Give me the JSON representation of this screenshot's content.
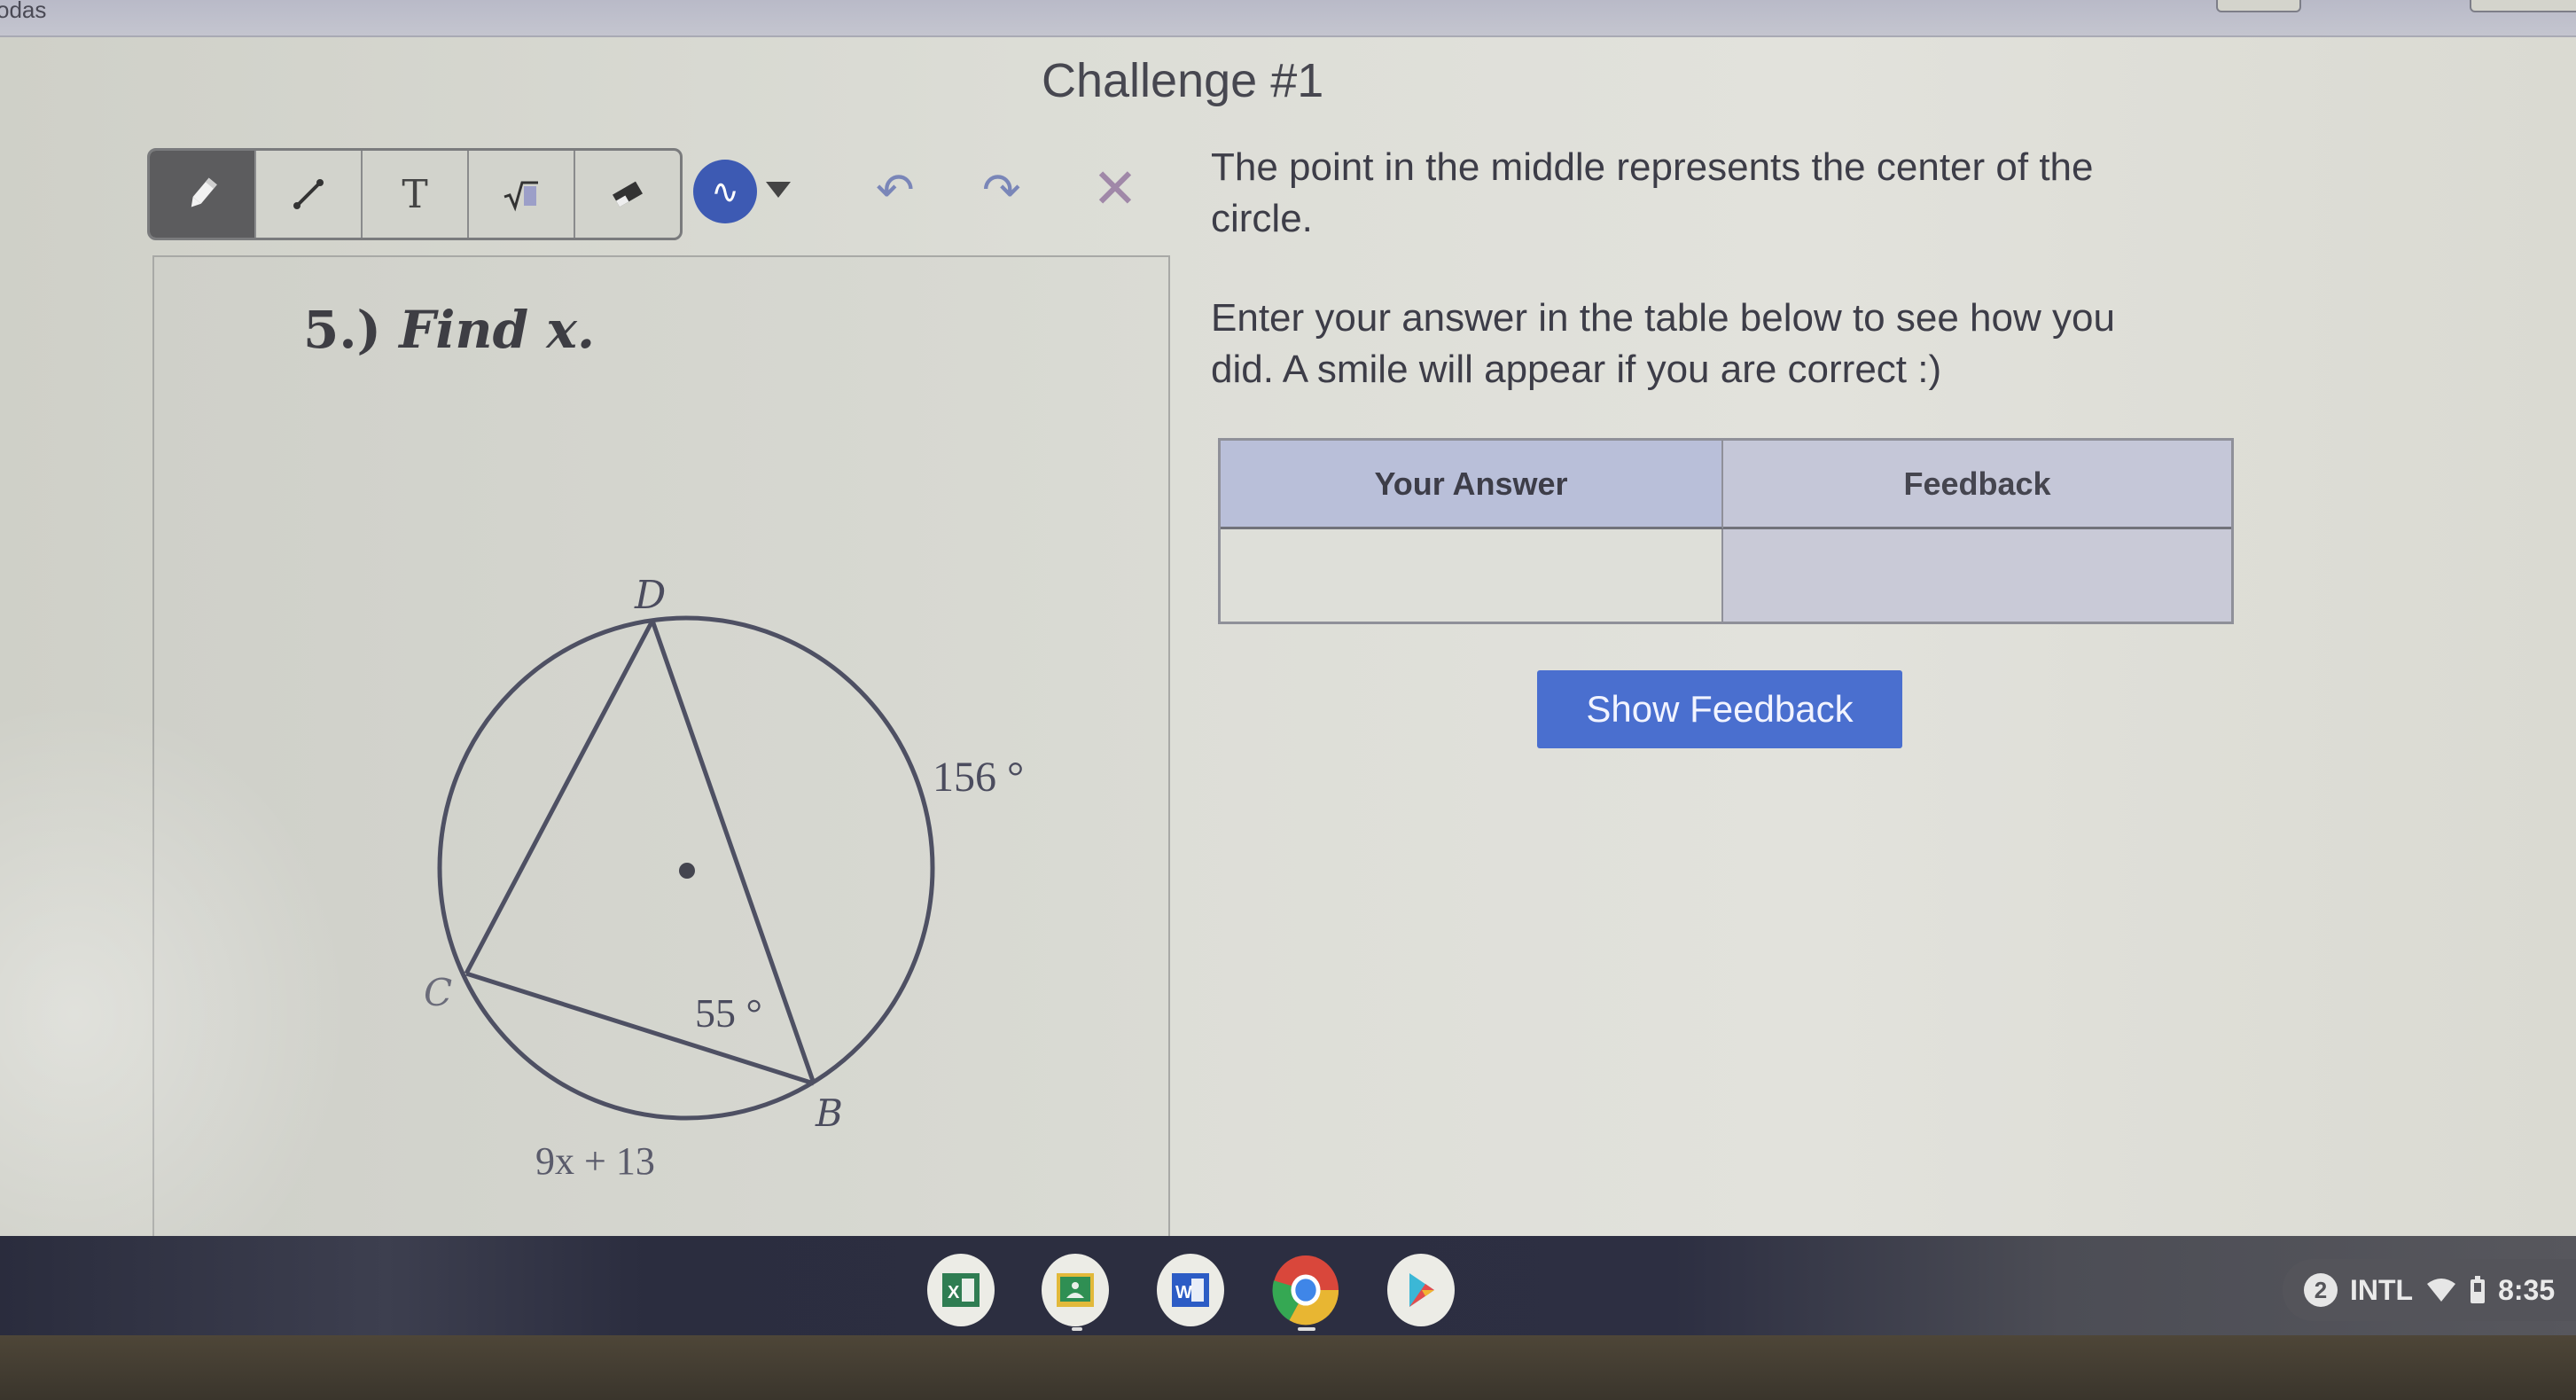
{
  "window": {
    "corner_text": "odas"
  },
  "page": {
    "title": "Challenge #1"
  },
  "toolbar": {
    "tools": [
      {
        "name": "pencil",
        "glyph": "✎",
        "active": true
      },
      {
        "name": "line",
        "glyph": "⟋",
        "active": false
      },
      {
        "name": "text",
        "glyph": "T",
        "active": false
      },
      {
        "name": "math",
        "glyph": "√▯",
        "active": false
      },
      {
        "name": "eraser",
        "glyph": "▰",
        "active": false
      }
    ],
    "color_button_glyph": "∿",
    "color": "#3d5ab3",
    "undo_glyph": "↶",
    "redo_glyph": "↷",
    "clear_glyph": "✕"
  },
  "problem": {
    "number": "5.)",
    "prompt": "Find",
    "variable": "x."
  },
  "diagram": {
    "points": {
      "D": "D",
      "C": "C",
      "B": "B"
    },
    "arc_label_db": "156 °",
    "angle_label_b": "55 °",
    "arc_label_cb": "9x + 13"
  },
  "instructions": {
    "line1": "The point in the middle represents the center of the",
    "line1b": "circle.",
    "line2": "Enter your answer in the table below to see how you",
    "line2b": "did. A smile will appear if you are correct :)"
  },
  "answer_table": {
    "headers": [
      "Your Answer",
      "Feedback"
    ],
    "answer_value": "",
    "feedback_value": ""
  },
  "buttons": {
    "show_feedback": "Show Feedback"
  },
  "shelf": {
    "apps": [
      {
        "name": "excel",
        "label": "X"
      },
      {
        "name": "google-classroom",
        "label": ""
      },
      {
        "name": "word",
        "label": "W"
      },
      {
        "name": "chrome",
        "label": ""
      },
      {
        "name": "play-store",
        "label": ""
      }
    ],
    "tray": {
      "notification_count": "2",
      "input_method": "INTL",
      "time": "8:35"
    }
  }
}
